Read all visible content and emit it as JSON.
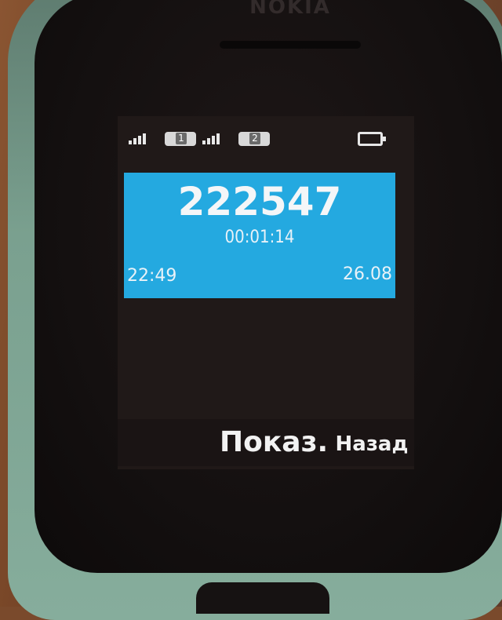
{
  "device": {
    "brand": "NOKIA"
  },
  "status_bar": {
    "sim1_label": "1",
    "sim2_label": "2",
    "signal_icon": "signal-bars-icon",
    "battery_icon": "battery-icon"
  },
  "call": {
    "number": "222547",
    "duration": "00:01:14",
    "time": "22:49",
    "date": "26.08"
  },
  "softkeys": {
    "left_label": "Показ.",
    "right_label": "Назад"
  },
  "colors": {
    "panel_accent": "#24a9e0",
    "screen_bg": "#201918"
  }
}
